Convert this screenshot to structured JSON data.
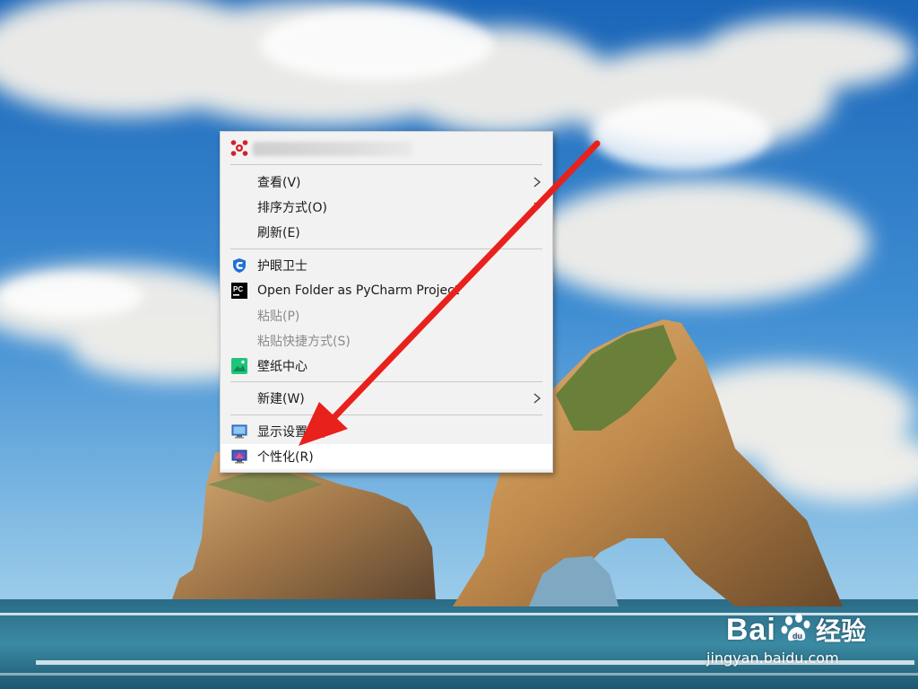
{
  "context_menu": {
    "header_app_icon": "app-flower-icon",
    "items": [
      {
        "label": "查看(V)",
        "has_submenu": true
      },
      {
        "label": "排序方式(O)",
        "has_submenu": true
      },
      {
        "label": "刷新(E)",
        "has_submenu": false
      },
      {
        "label": "护眼卫士",
        "icon": "shield-icon"
      },
      {
        "label": "Open Folder as PyCharm Project",
        "icon": "pycharm-icon"
      },
      {
        "label": "粘贴(P)",
        "disabled": true
      },
      {
        "label": "粘贴快捷方式(S)",
        "disabled": true
      },
      {
        "label": "壁纸中心",
        "icon": "wallpaper-icon"
      },
      {
        "label": "新建(W)",
        "has_submenu": true
      },
      {
        "label": "显示设置(D)",
        "icon": "display-icon"
      },
      {
        "label": "个性化(R)",
        "icon": "personalize-icon",
        "highlighted": true
      }
    ]
  },
  "watermark": {
    "brand": "Bai",
    "brand_cn": "经验",
    "url": "jingyan.baidu.com"
  },
  "colors": {
    "menu_bg": "#f2f2f2",
    "hover_bg": "#ffffff",
    "arrow": "#e8211d",
    "sky_top": "#1f6fc0",
    "sea": "#2f6f88"
  }
}
